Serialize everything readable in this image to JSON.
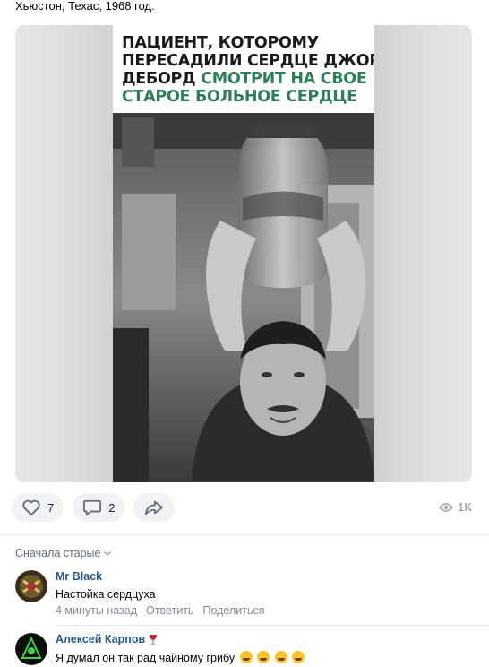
{
  "post": {
    "caption": "Хьюстон, Техас, 1968 год.",
    "poster": {
      "line1": "ПАЦИЕНТ, КОТОРОМУ",
      "line2": "ПЕРЕСАДИЛИ СЕРДЦЕ ДЖОРДЖ",
      "line3_dark": "ДЕБОРД ",
      "line3_green": "СМОТРИТ НА СВОЕ",
      "line4_green": "СТАРОЕ БОЛЬНОЕ СЕРДЦЕ"
    }
  },
  "actions": {
    "likes": "7",
    "comments": "2",
    "views": "1K",
    "icons": [
      "heart-icon",
      "comment-icon",
      "share-icon",
      "eye-icon"
    ]
  },
  "comments_header": {
    "sort_label": "Сначала старые"
  },
  "comments": [
    {
      "author": "Mr Black",
      "text": "Настойка сердцуха",
      "time": "4 минуты назад",
      "reply": "Ответить",
      "share": "Поделиться"
    },
    {
      "author": "Алексей Карпов",
      "text": "Я думал он так рад чайному грибу",
      "emoji_count": 4
    }
  ],
  "colors": {
    "link": "#2a5885",
    "muted": "#818c99",
    "pill_bg": "#f0f2f5",
    "poster_green": "#2e7d5b"
  }
}
